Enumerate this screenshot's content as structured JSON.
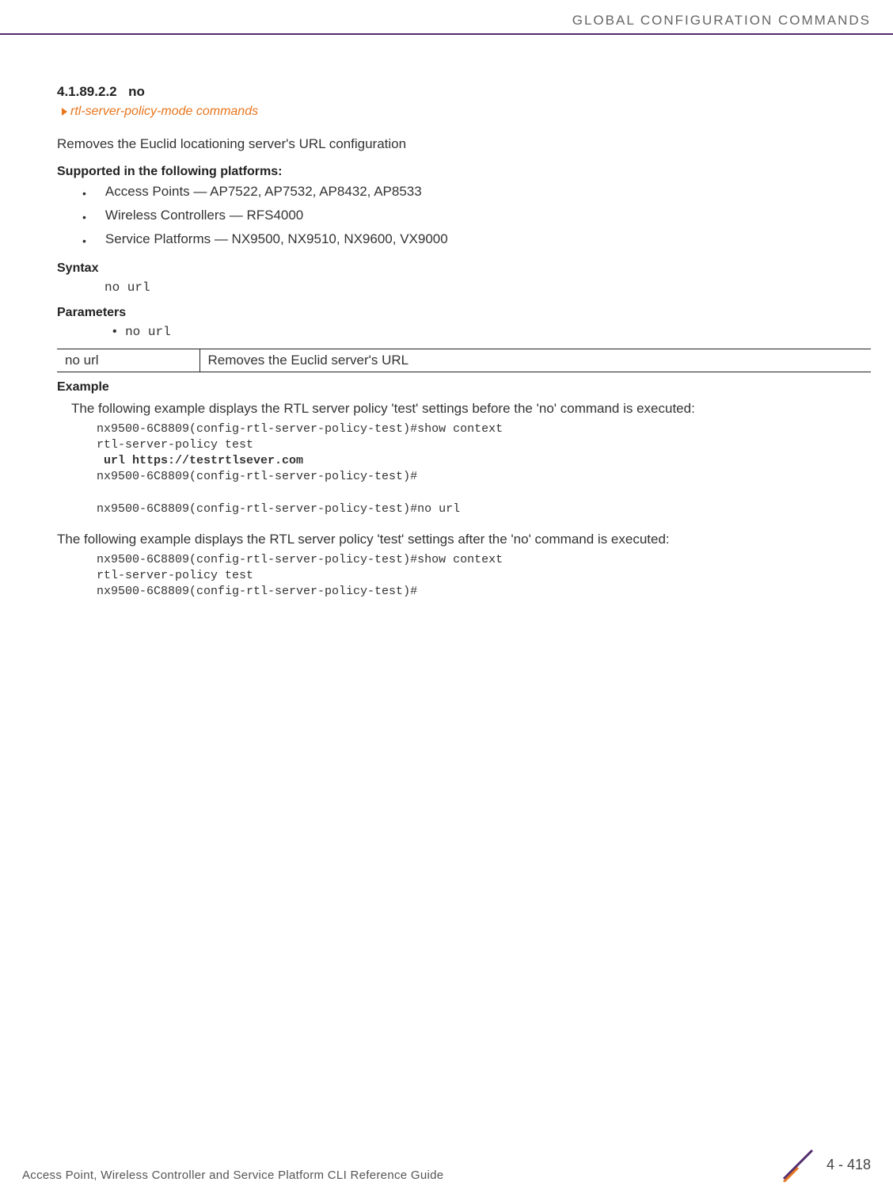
{
  "header": {
    "title": "GLOBAL CONFIGURATION COMMANDS"
  },
  "section": {
    "number": "4.1.89.2.2",
    "title": "no",
    "breadcrumb": "rtl-server-policy-mode commands"
  },
  "intro": "Removes the Euclid locationing server's URL configuration",
  "platforms": {
    "heading": "Supported in the following platforms:",
    "items": [
      "Access Points — AP7522, AP7532, AP8432, AP8533",
      "Wireless Controllers — RFS4000",
      "Service Platforms — NX9500, NX9510, NX9600, VX9000"
    ]
  },
  "syntax": {
    "heading": "Syntax",
    "code": "no url"
  },
  "parameters": {
    "heading": "Parameters",
    "item": "no url",
    "table": {
      "col1": "no url",
      "col2": "Removes the Euclid server's URL"
    }
  },
  "example": {
    "heading": "Example",
    "text_before": "The following example displays the RTL server policy 'test' settings before the 'no' command is executed:",
    "code1_line1": "nx9500-6C8809(config-rtl-server-policy-test)#show context",
    "code1_line2": "rtl-server-policy test",
    "code1_bold": " url https://testrtlsever.com",
    "code1_line4": "nx9500-6C8809(config-rtl-server-policy-test)#",
    "code1_line5": "nx9500-6C8809(config-rtl-server-policy-test)#no url",
    "text_after": "The following example displays the RTL server policy 'test' settings after the 'no' command is executed:",
    "code2_line1": "nx9500-6C8809(config-rtl-server-policy-test)#show context",
    "code2_line2": "rtl-server-policy test",
    "code2_line3": "nx9500-6C8809(config-rtl-server-policy-test)#"
  },
  "footer": {
    "guide": "Access Point, Wireless Controller and Service Platform CLI Reference Guide",
    "page": "4 - 418"
  }
}
